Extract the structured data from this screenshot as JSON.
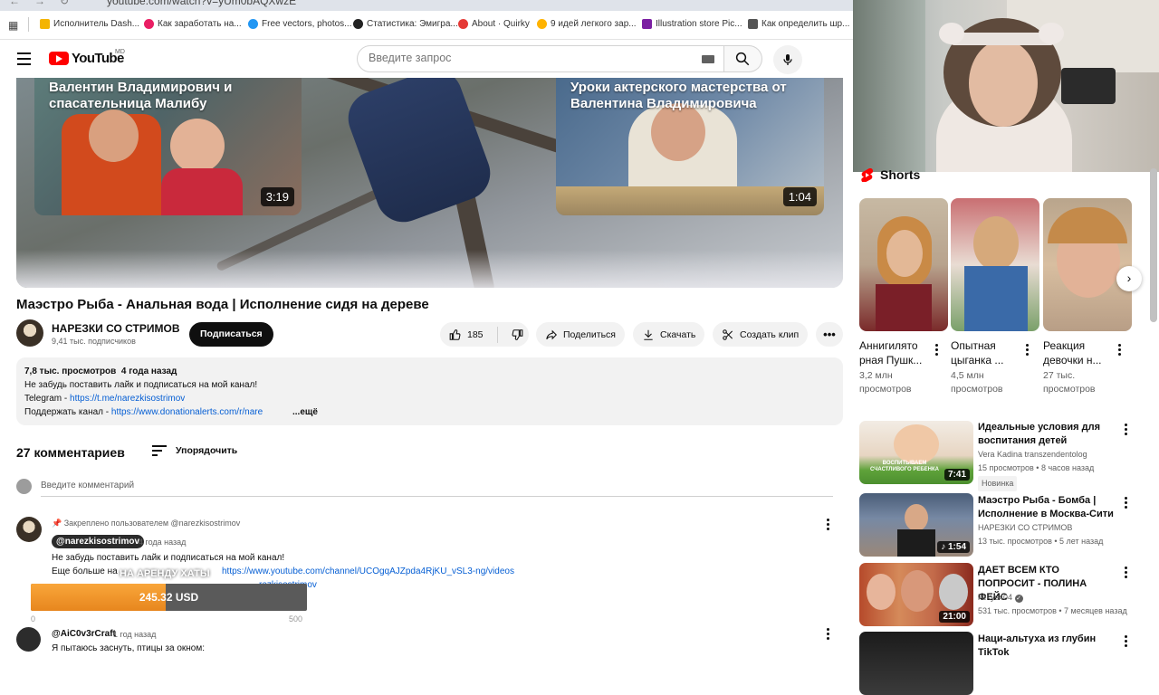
{
  "browser": {
    "url": "youtube.com/watch?v=yUm0bAQXwzE",
    "bookmarks": [
      {
        "label": "Исполнитель Dash...",
        "color": "#f4b400"
      },
      {
        "label": "Как заработать на...",
        "color": "#e91e63"
      },
      {
        "label": "Free vectors, photos...",
        "color": "#2196f3"
      },
      {
        "label": "Статистика: Эмигра...",
        "color": "#222222"
      },
      {
        "label": "About · Quirky",
        "color": "#e53935"
      },
      {
        "label": "9 идей легкого зар...",
        "color": "#ffb300"
      },
      {
        "label": "Illustration store Pic...",
        "color": "#7b1fa2"
      },
      {
        "label": "Как определить шр...",
        "color": "#555555"
      }
    ]
  },
  "header": {
    "logo": "YouTube",
    "logo_sup": "MD",
    "search_placeholder": "Введите запрос"
  },
  "video": {
    "endcards": [
      {
        "title": "Валентин Владимирович и спасательница Малибу",
        "duration": "3:19"
      },
      {
        "title": "Уроки актерского мастерства от Валентина Владимировича",
        "duration": "1:04"
      }
    ],
    "title": "Маэстро Рыба - Анальная вода | Исполнение сидя на дереве",
    "channel": "НАРЕЗКИ СО СТРИМОВ",
    "subscribers": "9,41 тыс. подписчиков",
    "subscribe_label": "Подписаться",
    "likes": "185",
    "share_label": "Поделиться",
    "download_label": "Скачать",
    "clip_label": "Создать клип"
  },
  "description": {
    "views": "7,8 тыс. просмотров",
    "date": "4 года назад",
    "line1": "Не забудь поставить лайк и подписаться на мой канал!",
    "telegram_label": "Telegram - ",
    "telegram_link": "https://t.me/narezkisostrimov",
    "support_label": "Поддержать канал - ",
    "support_link": "https://www.donationalerts.com/r/nare",
    "more": "...ещё"
  },
  "comments": {
    "count": "27 комментариев",
    "sort_label": "Упорядочить",
    "add_placeholder": "Введите комментарий",
    "pinned_label": "Закреплено пользователем @narezkisostrimov",
    "items": [
      {
        "author": "@narezkisostrimov",
        "time": "4 года назад",
        "line1": "Не забудь поставить лайк и подписаться на мой канал!",
        "line2_prefix": "Еще больше на",
        "line2_link": "https://www.youtube.com/channel/UCOgqAJZpda4RjKU_vSL3-ng/videos",
        "line3_link": "rezkisostrimov"
      },
      {
        "author": "@AiC0v3rCraft",
        "time": "1 год назад",
        "line1": "Я пытаюсь заснуть, птицы за окном:"
      }
    ]
  },
  "donation": {
    "amount": "245.32 USD",
    "caption": "НА АРЕНДУ ХАТЫ",
    "start": "0",
    "goal": "500",
    "progress": 0.49
  },
  "shorts": {
    "heading": "Shorts",
    "items": [
      {
        "title": "Аннигилято рная Пушк...",
        "views": "3,2 млн просмотров"
      },
      {
        "title": "Опытная цыганка ...",
        "views": "4,5 млн просмотров"
      },
      {
        "title": "Реакция девочки н...",
        "views": "27 тыс. просмотров"
      }
    ]
  },
  "recommended": [
    {
      "title": "Идеальные условия для воспитания детей",
      "channel": "Vera Kadina transzendentolog",
      "meta": "15 просмотров • 8 часов назад",
      "badge": "Новинка",
      "duration": "7:41",
      "thumb_text": "ВОСПИТЫВАЕМ СЧАСТЛИВОГО РЕБЕНКА"
    },
    {
      "title": "Маэстро Рыба - Бомба | Исполнение в Москва-Сити",
      "channel": "НАРЕЗКИ СО СТРИМОВ",
      "meta": "13 тыс. просмотров • 5 лет назад",
      "duration": "1:54"
    },
    {
      "title": "ДАЕТ ВСЕМ КТО ПОПРОСИТ - ПОЛИНА ФЕЙС",
      "channel": "kekys404",
      "meta": "531 тыс. просмотров • 7 месяцев назад",
      "duration": "21:00"
    },
    {
      "title": "Наци-альтуха из глубин TikTok",
      "channel": "",
      "meta": ""
    }
  ]
}
